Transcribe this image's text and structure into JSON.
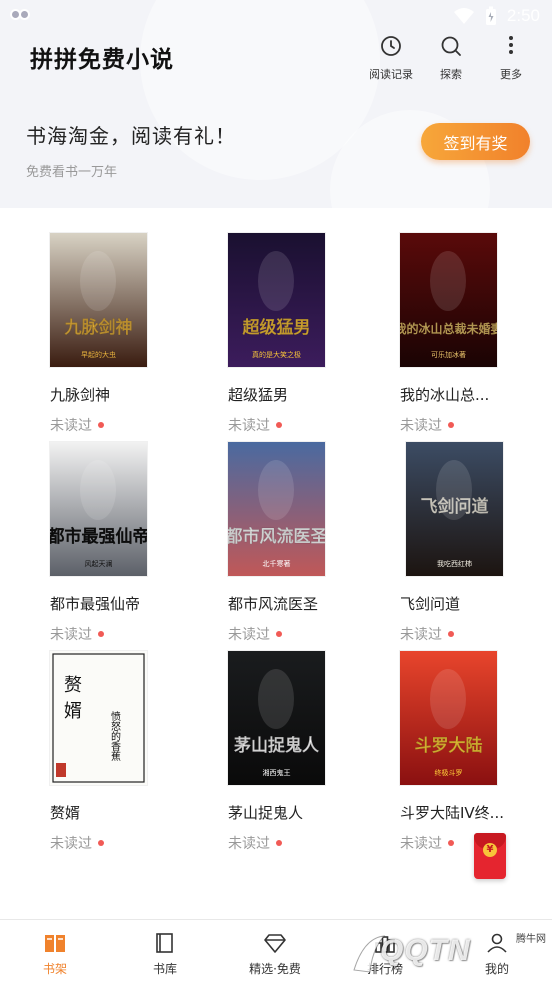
{
  "status_bar": {
    "time": "2:50"
  },
  "header": {
    "app_title": "拼拼免费小说",
    "actions": [
      {
        "label": "阅读记录",
        "icon": "clock-icon"
      },
      {
        "label": "探索",
        "icon": "search-icon"
      },
      {
        "label": "更多",
        "icon": "more-vertical-icon"
      }
    ]
  },
  "promo": {
    "title": "书海淘金，阅读有礼！",
    "subtitle": "免费看书一万年",
    "button_label": "签到有奖"
  },
  "books": [
    {
      "title": "九脉剑神",
      "status": "未读过",
      "cover_text": "九脉剑神",
      "cover_small": "早起的大虫",
      "cover_colors": [
        "#d8d2c4",
        "#3a1c10"
      ],
      "accent": "#e8b23c"
    },
    {
      "title": "超级猛男",
      "status": "未读过",
      "cover_text": "超级猛男",
      "cover_small": "真的是大笑之极",
      "cover_colors": [
        "#1a1030",
        "#3c1c5c"
      ],
      "accent": "#f6c23a"
    },
    {
      "title": "我的冰山总...",
      "status": "未读过",
      "cover_text": "我的冰山总裁未婚妻",
      "cover_small": "可乐加冰著",
      "cover_colors": [
        "#5a0a0a",
        "#1a0404"
      ],
      "accent": "#e8c36a"
    },
    {
      "title": "都市最强仙帝",
      "status": "未读过",
      "cover_text": "都市最强仙帝",
      "cover_small": "风起天澜",
      "cover_colors": [
        "#f2f2f2",
        "#5c6068"
      ],
      "accent": "#111111"
    },
    {
      "title": "都市风流医圣",
      "status": "未读过",
      "cover_text": "都市风流医圣",
      "cover_small": "北千寒著",
      "cover_colors": [
        "#4a6aa0",
        "#c05858"
      ],
      "accent": "#ffffff"
    },
    {
      "title": "飞剑问道",
      "status": "未读过",
      "cover_text": "飞剑问道",
      "cover_small": "我吃西红柿",
      "cover_colors": [
        "#3c4c64",
        "#1c1410"
      ],
      "accent": "#f4f0e4"
    },
    {
      "title": "赘婿",
      "status": "未读过",
      "cover_text": "赘婿",
      "cover_small": "愤怒的香蕉",
      "cover_colors": [
        "#fbfbf8",
        "#fbfbf8"
      ],
      "accent": "#111111"
    },
    {
      "title": "茅山捉鬼人",
      "status": "未读过",
      "cover_text": "茅山捉鬼人",
      "cover_small": "湘西鬼王",
      "cover_colors": [
        "#1a1c1e",
        "#0a0a0a"
      ],
      "accent": "#ffffff"
    },
    {
      "title": "斗罗大陆IV终...",
      "status": "未读过",
      "cover_text": "斗罗大陆",
      "cover_small": "终极斗罗",
      "cover_colors": [
        "#e8452c",
        "#8a1010"
      ],
      "accent": "#ffd23a"
    }
  ],
  "tabbar": {
    "tabs": [
      {
        "label": "书架",
        "icon": "bookshelf-icon",
        "active": true
      },
      {
        "label": "书库",
        "icon": "library-book-icon",
        "active": false
      },
      {
        "label": "精选·免费",
        "icon": "diamond-icon",
        "active": false
      },
      {
        "label": "排行榜",
        "icon": "ranking-icon",
        "active": false
      },
      {
        "label": "我的",
        "icon": "profile-icon",
        "active": false
      }
    ]
  },
  "watermark": {
    "text": "QQTN",
    "small": "腾牛网"
  },
  "colors": {
    "accent": "#f0822c",
    "red_dot": "#f15a55",
    "header_bg": "#f3f4f8"
  }
}
